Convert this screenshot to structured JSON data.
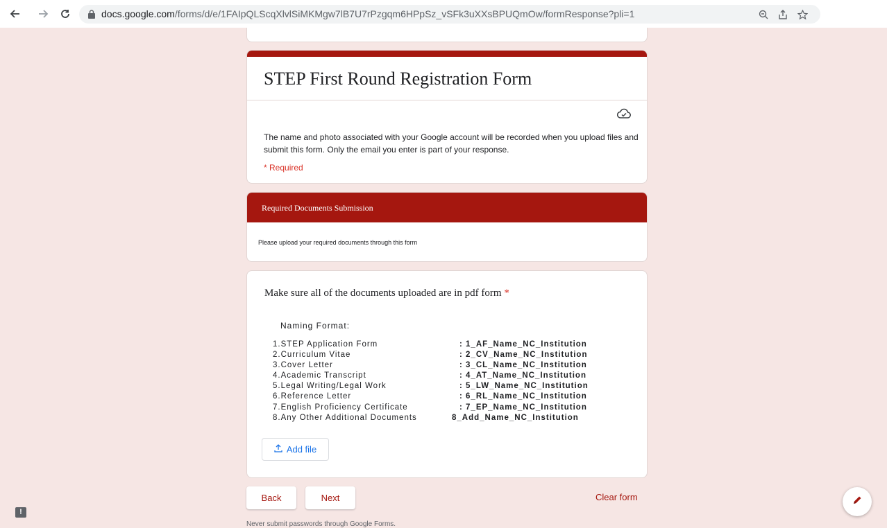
{
  "browser": {
    "url_domain": "docs.google.com",
    "url_path": "/forms/d/e/1FAIpQLScqXlvlSiMKMgw7lB7U7rPzgqm6HPpSz_vSFk3uXXsBPUQmOw/formResponse?pli=1"
  },
  "form": {
    "title": "STEP First Round Registration Form",
    "notice": "The name and photo associated with your Google account will be recorded when you upload files and submit this form. Only the email you enter is part of your response.",
    "required_label": "* Required"
  },
  "section": {
    "title": "Required Documents Submission",
    "description": "Please upload your required documents through this form"
  },
  "question": {
    "title": "Make sure all of the documents uploaded are in pdf form",
    "required_mark": "*",
    "naming_heading": "Naming Format:",
    "items": [
      {
        "label": "1.STEP Application Form",
        "value": ": 1_AF_Name_NC_Institution"
      },
      {
        "label": "2.Curriculum Vitae",
        "value": ": 2_CV_Name_NC_Institution"
      },
      {
        "label": "3.Cover Letter",
        "value": ": 3_CL_Name_NC_Institution"
      },
      {
        "label": "4.Academic Transcript",
        "value": ": 4_AT_Name_NC_Institution"
      },
      {
        "label": "5.Legal Writing/Legal Work",
        "value": ": 5_LW_Name_NC_Institution"
      },
      {
        "label": "6.Reference Letter",
        "value": ": 6_RL_Name_NC_Institution"
      },
      {
        "label": "7.English Proficiency Certificate",
        "value": ": 7_EP_Name_NC_Institution"
      },
      {
        "label": "8.Any Other Additional Documents",
        "value": "8_Add_Name_NC_Institution"
      }
    ],
    "add_file_label": "Add file"
  },
  "nav": {
    "back_label": "Back",
    "next_label": "Next",
    "clear_label": "Clear form"
  },
  "footer": "Never submit passwords through Google Forms.",
  "feedback_glyph": "!",
  "colors": {
    "accent": "#a5170f",
    "background": "#f6e6e4",
    "link_blue": "#1a73e8",
    "required_red": "#d93025"
  }
}
